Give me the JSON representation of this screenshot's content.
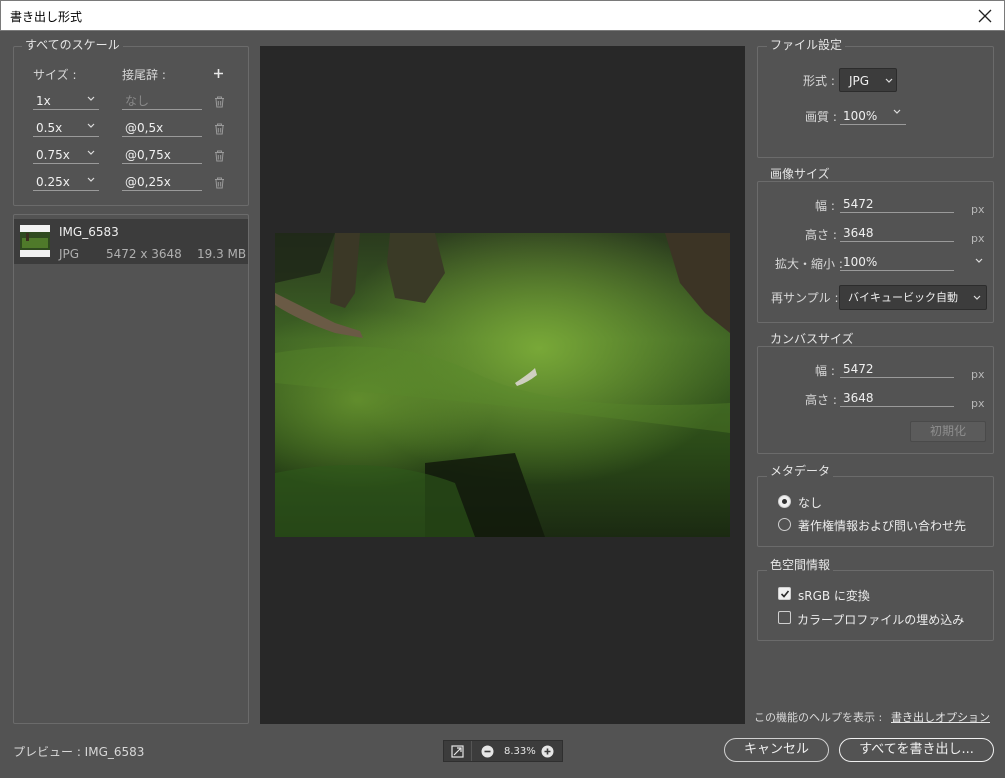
{
  "window": {
    "title": "書き出し形式"
  },
  "scales": {
    "group_title": "すべてのスケール",
    "size_header": "サイズ :",
    "suffix_header": "接尾辞 :",
    "add_symbol": "+",
    "rows": [
      {
        "size": "1x",
        "suffix": "なし",
        "suffix_is_placeholder": true
      },
      {
        "size": "0.5x",
        "suffix": "@0,5x"
      },
      {
        "size": "0.75x",
        "suffix": "@0,75x"
      },
      {
        "size": "0.25x",
        "suffix": "@0,25x"
      }
    ]
  },
  "asset": {
    "name": "IMG_6583",
    "format": "JPG",
    "dimensions": "5472 x 3648",
    "filesize": "19.3 MB"
  },
  "file_settings": {
    "group_title": "ファイル設定",
    "format_label": "形式 :",
    "format_value": "JPG",
    "quality_label": "画質 :",
    "quality_value": "100%"
  },
  "image_size": {
    "group_title": "画像サイズ",
    "width_label": "幅 :",
    "width_value": "5472",
    "height_label": "高さ :",
    "height_value": "3648",
    "scale_label": "拡大・縮小 :",
    "scale_value": "100%",
    "resample_label": "再サンプル :",
    "resample_value": "バイキュービック自動",
    "unit": "px"
  },
  "canvas_size": {
    "group_title": "カンバスサイズ",
    "width_label": "幅 :",
    "width_value": "5472",
    "height_label": "高さ :",
    "height_value": "3648",
    "unit": "px",
    "reset_button": "初期化"
  },
  "metadata": {
    "group_title": "メタデータ",
    "option_none": "なし",
    "option_copyright": "著作権情報および問い合わせ先",
    "selected": "none"
  },
  "color_space": {
    "group_title": "色空間情報",
    "convert_srgb": "sRGB に変換",
    "convert_srgb_checked": true,
    "embed_profile": "カラープロファイルの埋め込み",
    "embed_profile_checked": false
  },
  "help": {
    "prefix": "この機能のヘルプを表示 :",
    "link": "書き出しオプション"
  },
  "footer": {
    "preview_label": "プレビュー : IMG_6583",
    "zoom": "8.33%",
    "cancel_button": "キャンセル",
    "export_button": "すべてを書き出し..."
  },
  "colors": {
    "dialog_bg": "#535353",
    "preview_bg": "#282828",
    "selected_row_bg": "#3c3c3c"
  },
  "icons": [
    "close-icon",
    "add-icon",
    "chevron-down-icon",
    "trash-icon",
    "fit-screen-icon",
    "zoom-out-icon",
    "zoom-in-icon"
  ]
}
